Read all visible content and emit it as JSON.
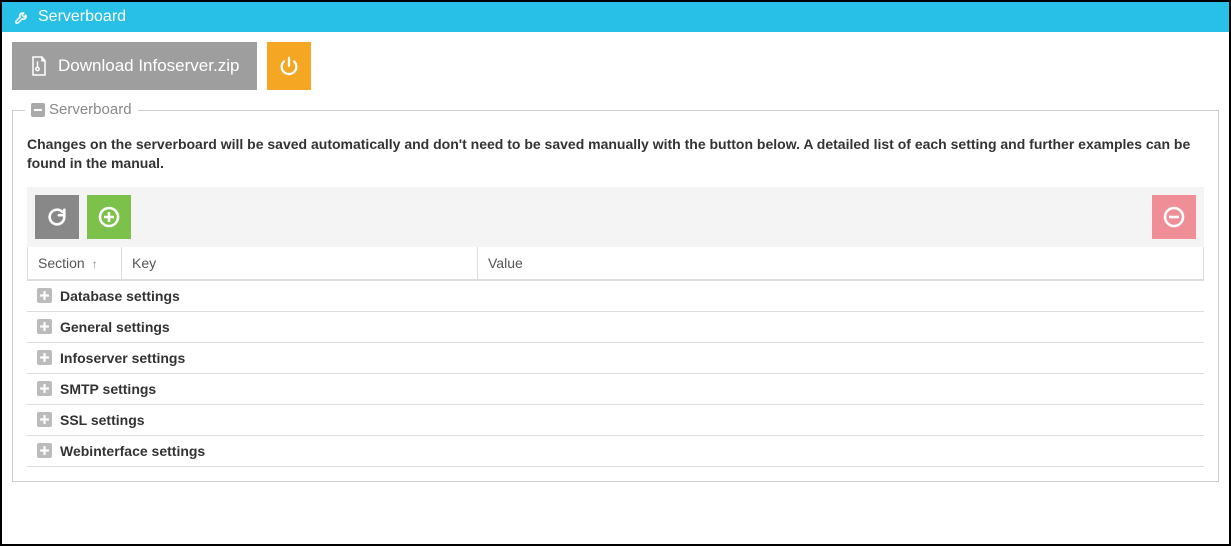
{
  "topbar": {
    "title": "Serverboard"
  },
  "toolbar": {
    "download_label": "Download Infoserver.zip"
  },
  "fieldset": {
    "legend": "Serverboard",
    "notice": "Changes on the serverboard will be saved automatically and don't need to be saved manually with the button below. A detailed list of each setting and further examples can be found in the manual."
  },
  "table": {
    "columns": {
      "section": "Section",
      "key": "Key",
      "value": "Value"
    },
    "groups": [
      {
        "label": "Database settings"
      },
      {
        "label": "General settings"
      },
      {
        "label": "Infoserver settings"
      },
      {
        "label": "SMTP settings"
      },
      {
        "label": "SSL settings"
      },
      {
        "label": "Webinterface settings"
      }
    ]
  }
}
